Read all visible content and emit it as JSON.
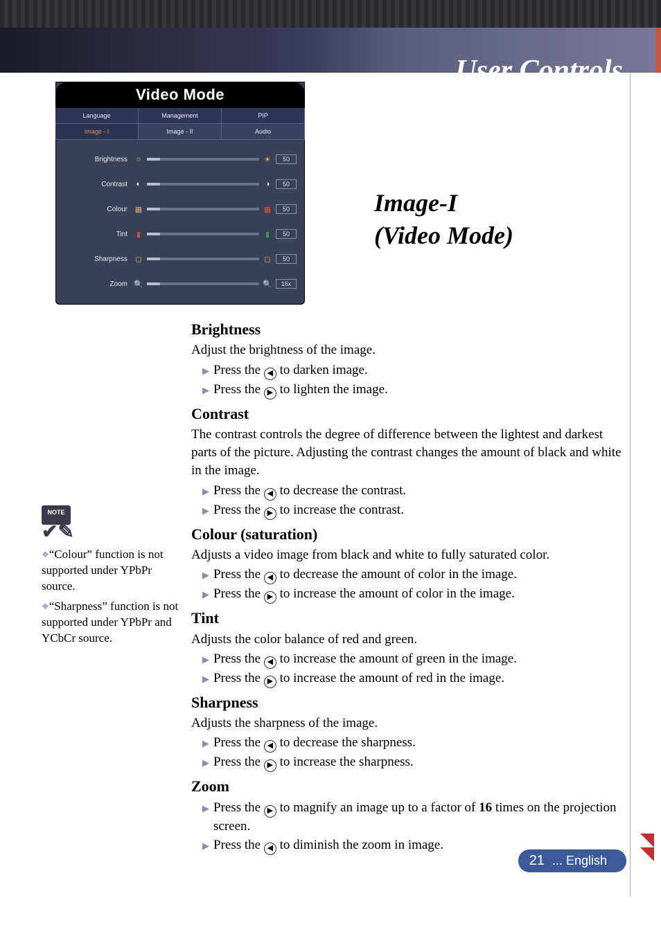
{
  "header": {
    "title": "User Controls"
  },
  "osd": {
    "title": "Video Mode",
    "tabs_top": [
      "Language",
      "Management",
      "PIP"
    ],
    "tabs_bottom": [
      "Image - I",
      "Image - II",
      "Audio"
    ],
    "active_tab": "Image - I",
    "rows": [
      {
        "label": "Brightness",
        "value": "50"
      },
      {
        "label": "Contrast",
        "value": "50"
      },
      {
        "label": "Colour",
        "value": "50"
      },
      {
        "label": "Tint",
        "value": "50"
      },
      {
        "label": "Sharpness",
        "value": "50"
      },
      {
        "label": "Zoom",
        "value": "16x"
      }
    ]
  },
  "section_title_line1": "Image-I",
  "section_title_line2": "(Video Mode)",
  "sections": {
    "brightness": {
      "h": "Brightness",
      "p": "Adjust the brightness of the image.",
      "l1a": "Press the ",
      "l1b": " to darken image.",
      "l2a": "Press the ",
      "l2b": " to lighten the image."
    },
    "contrast": {
      "h": "Contrast",
      "p": "The contrast controls the degree of difference between the lightest and darkest parts of the picture. Adjusting the contrast changes the amount of black and white in the image.",
      "l1a": "Press the ",
      "l1b": " to decrease the contrast.",
      "l2a": "Press the ",
      "l2b": " to increase the contrast."
    },
    "colour": {
      "h": "Colour (saturation)",
      "p": "Adjusts a video image from black and white to fully saturated color.",
      "l1a": "Press the ",
      "l1b": " to decrease the amount of color in the image.",
      "l2a": "Press the ",
      "l2b": " to increase the amount of color in the image."
    },
    "tint": {
      "h": "Tint",
      "p": "Adjusts the color balance of red and green.",
      "l1a": "Press the ",
      "l1b": " to increase the amount of green in the image.",
      "l2a": "Press the ",
      "l2b": " to increase the amount of red  in the image."
    },
    "sharpness": {
      "h": "Sharpness",
      "p": "Adjusts the sharpness of the image.",
      "l1a": "Press the ",
      "l1b": " to decrease the sharpness.",
      "l2a": "Press the ",
      "l2b": " to increase the sharpness."
    },
    "zoom": {
      "h": "Zoom",
      "l1a": "Press the ",
      "l1b_pre": " to magnify an image up to a factor of ",
      "l1b_bold": "16",
      "l1b_post": " times on the projection screen.",
      "l2a": "Press the ",
      "l2b": " to diminish the zoom in image."
    }
  },
  "note": {
    "badge": "NOTE",
    "n1": "“Colour” function is not supported under YPbPr source.",
    "n2": "“Sharpness” function is not supported under YPbPr and YCbCr source."
  },
  "footer": {
    "page": "21",
    "lang": "... English"
  }
}
